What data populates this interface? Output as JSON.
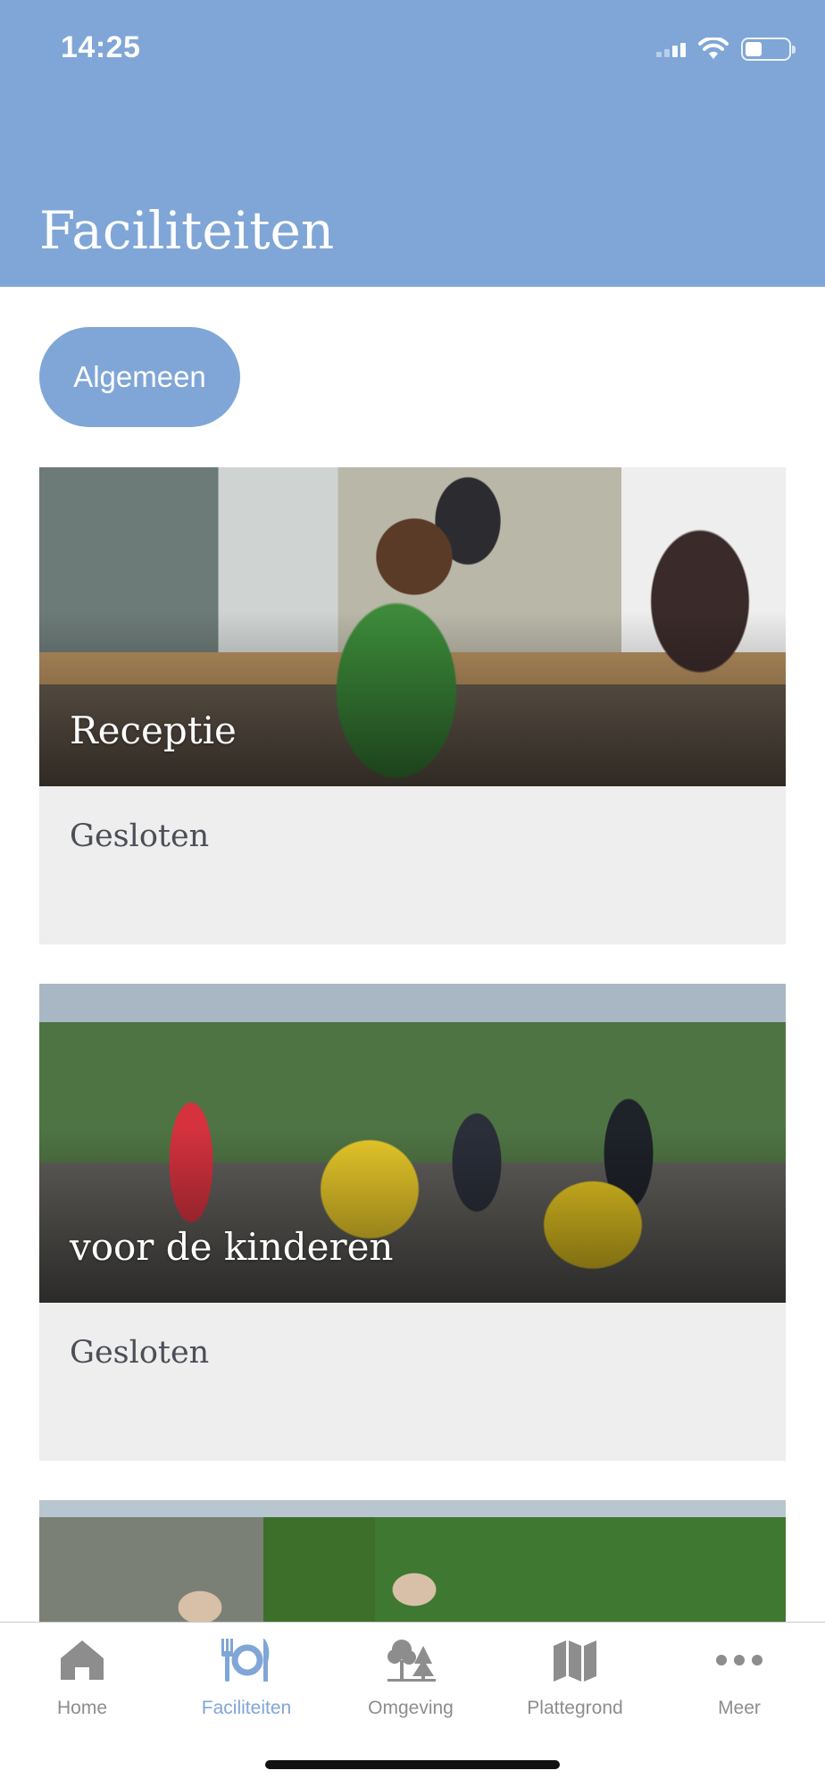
{
  "status_bar": {
    "time": "14:25"
  },
  "header": {
    "title": "Faciliteiten"
  },
  "filter": {
    "chip_label": "Algemeen"
  },
  "cards": [
    {
      "title": "Receptie",
      "status": "Gesloten",
      "image": "reception-desk-photo"
    },
    {
      "title": "voor de kinderen",
      "status": "Gesloten",
      "image": "kids-group-photo"
    },
    {
      "title": "",
      "status": "",
      "image": "campsite-entrance-photo"
    }
  ],
  "tabbar": {
    "items": [
      {
        "label": "Home",
        "icon": "home-icon",
        "active": false
      },
      {
        "label": "Faciliteiten",
        "icon": "cutlery-icon",
        "active": true
      },
      {
        "label": "Omgeving",
        "icon": "trees-icon",
        "active": false
      },
      {
        "label": "Plattegrond",
        "icon": "map-icon",
        "active": false
      },
      {
        "label": "Meer",
        "icon": "more-icon",
        "active": false
      }
    ]
  },
  "colors": {
    "accent": "#7fa6d6",
    "tab_inactive": "#8d8d8d",
    "card_footer": "#eeeeee"
  }
}
